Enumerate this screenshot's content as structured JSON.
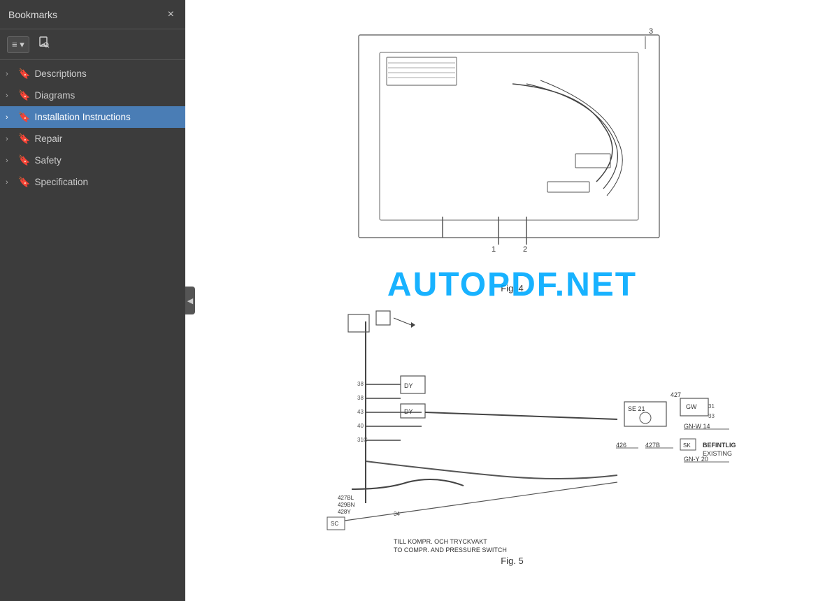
{
  "sidebar": {
    "title": "Bookmarks",
    "close_label": "×",
    "toolbar": {
      "view_btn_label": "≡ ▾",
      "bookmark_icon": "🔖"
    },
    "items": [
      {
        "id": "descriptions",
        "label": "Descriptions",
        "active": false
      },
      {
        "id": "diagrams",
        "label": "Diagrams",
        "active": false
      },
      {
        "id": "installation-instructions",
        "label": "Installation Instructions",
        "active": true
      },
      {
        "id": "repair",
        "label": "Repair",
        "active": false
      },
      {
        "id": "safety",
        "label": "Safety",
        "active": false
      },
      {
        "id": "specification",
        "label": "Specification",
        "active": false
      }
    ]
  },
  "collapse": {
    "icon": "◀"
  },
  "watermark": {
    "text": "AUTOPDF.NET"
  },
  "figures": {
    "fig4_label": "Fig. 4",
    "fig5_label": "Fig. 5",
    "fig5_caption1": "TILL KOMPR. OCH TRYCKVAKT",
    "fig5_caption2": "TO COMPR. AND PRESSURE SWITCH"
  }
}
